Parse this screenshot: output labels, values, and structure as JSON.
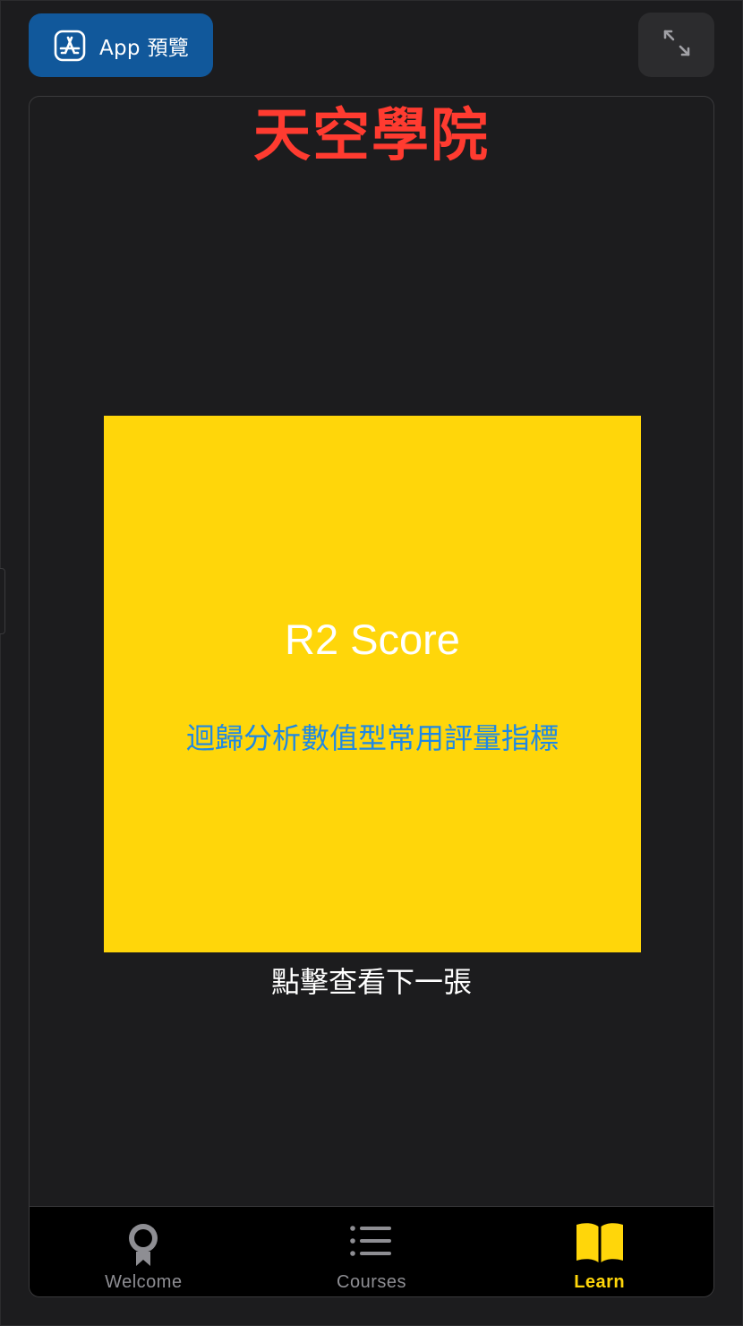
{
  "toolbar": {
    "preview_label": "App 預覽"
  },
  "app": {
    "title": "天空學院"
  },
  "flashcard": {
    "term": "R2 Score",
    "description": "迴歸分析數值型常用評量指標",
    "next_hint": "點擊查看下一張"
  },
  "tabs": [
    {
      "label": "Welcome",
      "icon": "award-ribbon-icon",
      "active": false
    },
    {
      "label": "Courses",
      "icon": "list-icon",
      "active": false
    },
    {
      "label": "Learn",
      "icon": "open-book-icon",
      "active": true
    }
  ],
  "colors": {
    "background": "#1c1c1e",
    "preview_button": "#11589b",
    "title": "#ff3b30",
    "card": "#ffd60a",
    "card_description": "#1e88e5",
    "tab_active": "#ffd60a",
    "tab_inactive": "#8e8e93"
  }
}
